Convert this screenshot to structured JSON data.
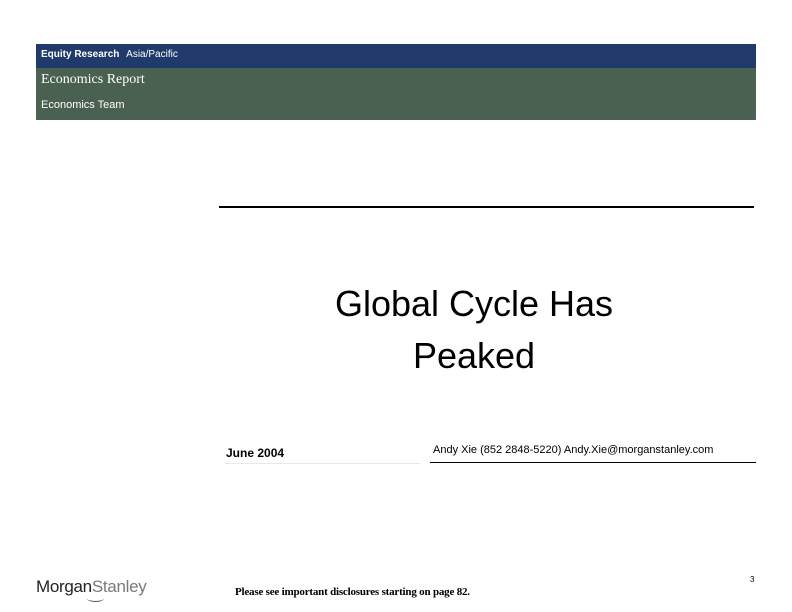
{
  "header": {
    "section": "Equity Research",
    "region": "Asia/Pacific",
    "report_type": "Economics Report",
    "team": "Economics Team"
  },
  "title": {
    "line1": "Global Cycle Has",
    "line2": "Peaked"
  },
  "meta": {
    "date": "June 2004",
    "author": "Andy Xie  (852 2848-5220)  Andy.Xie@morganstanley.com"
  },
  "footer": {
    "logo_part1": "Morgan",
    "logo_part2": "Stanley",
    "disclosure": "Please see important disclosures starting on page 82.",
    "page_number": "3"
  },
  "colors": {
    "navy_band": "#1f3a6b",
    "green_band": "#4a6152"
  }
}
